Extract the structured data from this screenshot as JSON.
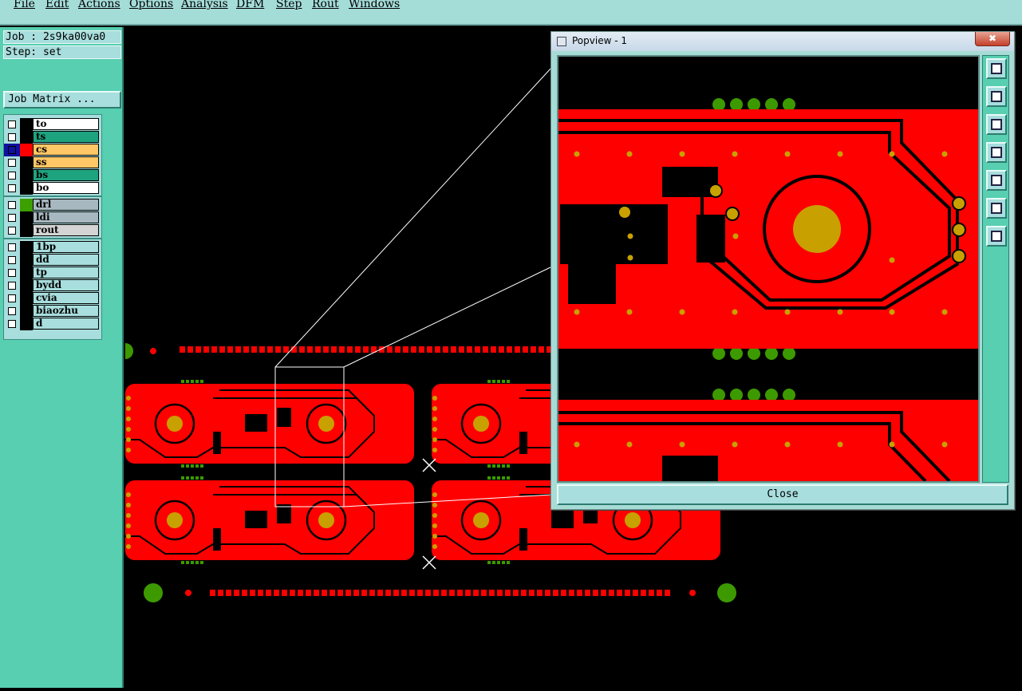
{
  "menu": [
    "File",
    "Edit",
    "Actions",
    "Options",
    "Analysis",
    "DFM",
    "Step",
    "Rout",
    "Windows"
  ],
  "job": "Job : 2s9ka00va0",
  "step": "Step: set",
  "job_matrix_label": "Job Matrix ...",
  "layers": [
    {
      "name": "to",
      "color": "#ffffff"
    },
    {
      "name": "ts",
      "color": "#1ea37f"
    },
    {
      "name": "cs",
      "color": "#ffc765",
      "swatch": "#ff0000",
      "active": true
    },
    {
      "name": "ss",
      "color": "#ffc765"
    },
    {
      "name": "bs",
      "color": "#1ea37f"
    },
    {
      "name": "bo",
      "color": "#ffffff"
    },
    {
      "name": "drl",
      "color": "#a8b8c0",
      "swatch": "#3ca000"
    },
    {
      "name": "ldi",
      "color": "#a8b8c0"
    },
    {
      "name": "rout",
      "color": "#d4d4d4"
    },
    {
      "name": "1bp",
      "color": "#a8dedd"
    },
    {
      "name": "dd",
      "color": "#a8dedd"
    },
    {
      "name": "tp",
      "color": "#a8dedd"
    },
    {
      "name": "bydd",
      "color": "#a8dedd"
    },
    {
      "name": "cvia",
      "color": "#a8dedd"
    },
    {
      "name": "biaozhu",
      "color": "#a8dedd"
    },
    {
      "name": "d",
      "color": "#a8dedd"
    }
  ],
  "popview": {
    "title": "Popview - 1",
    "close_x": "✖",
    "close_label": "Close",
    "tools": [
      "zoom-fit-icon",
      "pan-up-icon",
      "pan-down-icon",
      "pan-left-icon",
      "pan-right-icon",
      "zoom-out-icon",
      "zoom-in-icon"
    ]
  },
  "colors": {
    "copper": "#ff0000",
    "pad": "#c8a000",
    "drill": "#3c9a00",
    "panel": "#57cfb0"
  }
}
